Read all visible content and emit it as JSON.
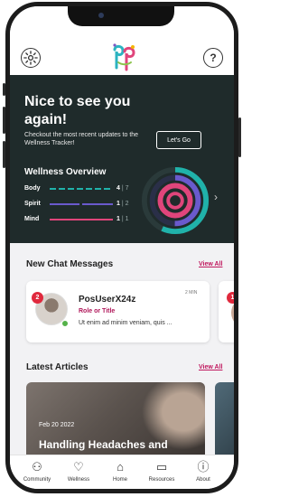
{
  "header": {
    "settings_icon": "gear-icon",
    "help_icon": "question-circle-icon",
    "help_glyph": "?"
  },
  "hero": {
    "title": "Nice to see you again!",
    "subtitle": "Checkout the most recent updates to the Wellness Tracker!",
    "cta_label": "Let's Go",
    "overview_title": "Wellness Overview",
    "metrics": [
      {
        "label": "Body",
        "value": "4",
        "total": "7",
        "color": "#20b2aa"
      },
      {
        "label": "Spirit",
        "value": "1",
        "total": "2",
        "color": "#6a5acd"
      },
      {
        "label": "Mind",
        "value": "1",
        "total": "1",
        "color": "#e0457b"
      }
    ],
    "next_glyph": "›"
  },
  "chat": {
    "heading": "New Chat Messages",
    "view_all": "View All",
    "cards": [
      {
        "badge": "2",
        "name": "PosUserX24z",
        "role": "Role or Title",
        "message": "Ut enim ad minim veniam, quis ...",
        "time": "2 MIN"
      },
      {
        "badge": "1"
      }
    ]
  },
  "articles": {
    "heading": "Latest Articles",
    "view_all": "View All",
    "items": [
      {
        "date": "Feb 20 2022",
        "title": "Handling Headaches and"
      }
    ]
  },
  "nav": [
    {
      "label": "Community",
      "icon": "community-icon",
      "glyph": "⚇"
    },
    {
      "label": "Wellness",
      "icon": "heart-icon",
      "glyph": "♡"
    },
    {
      "label": "Home",
      "icon": "home-icon",
      "glyph": "⌂"
    },
    {
      "label": "Resources",
      "icon": "book-icon",
      "glyph": "▭"
    },
    {
      "label": "About",
      "icon": "info-icon",
      "glyph": "ⓘ"
    }
  ]
}
